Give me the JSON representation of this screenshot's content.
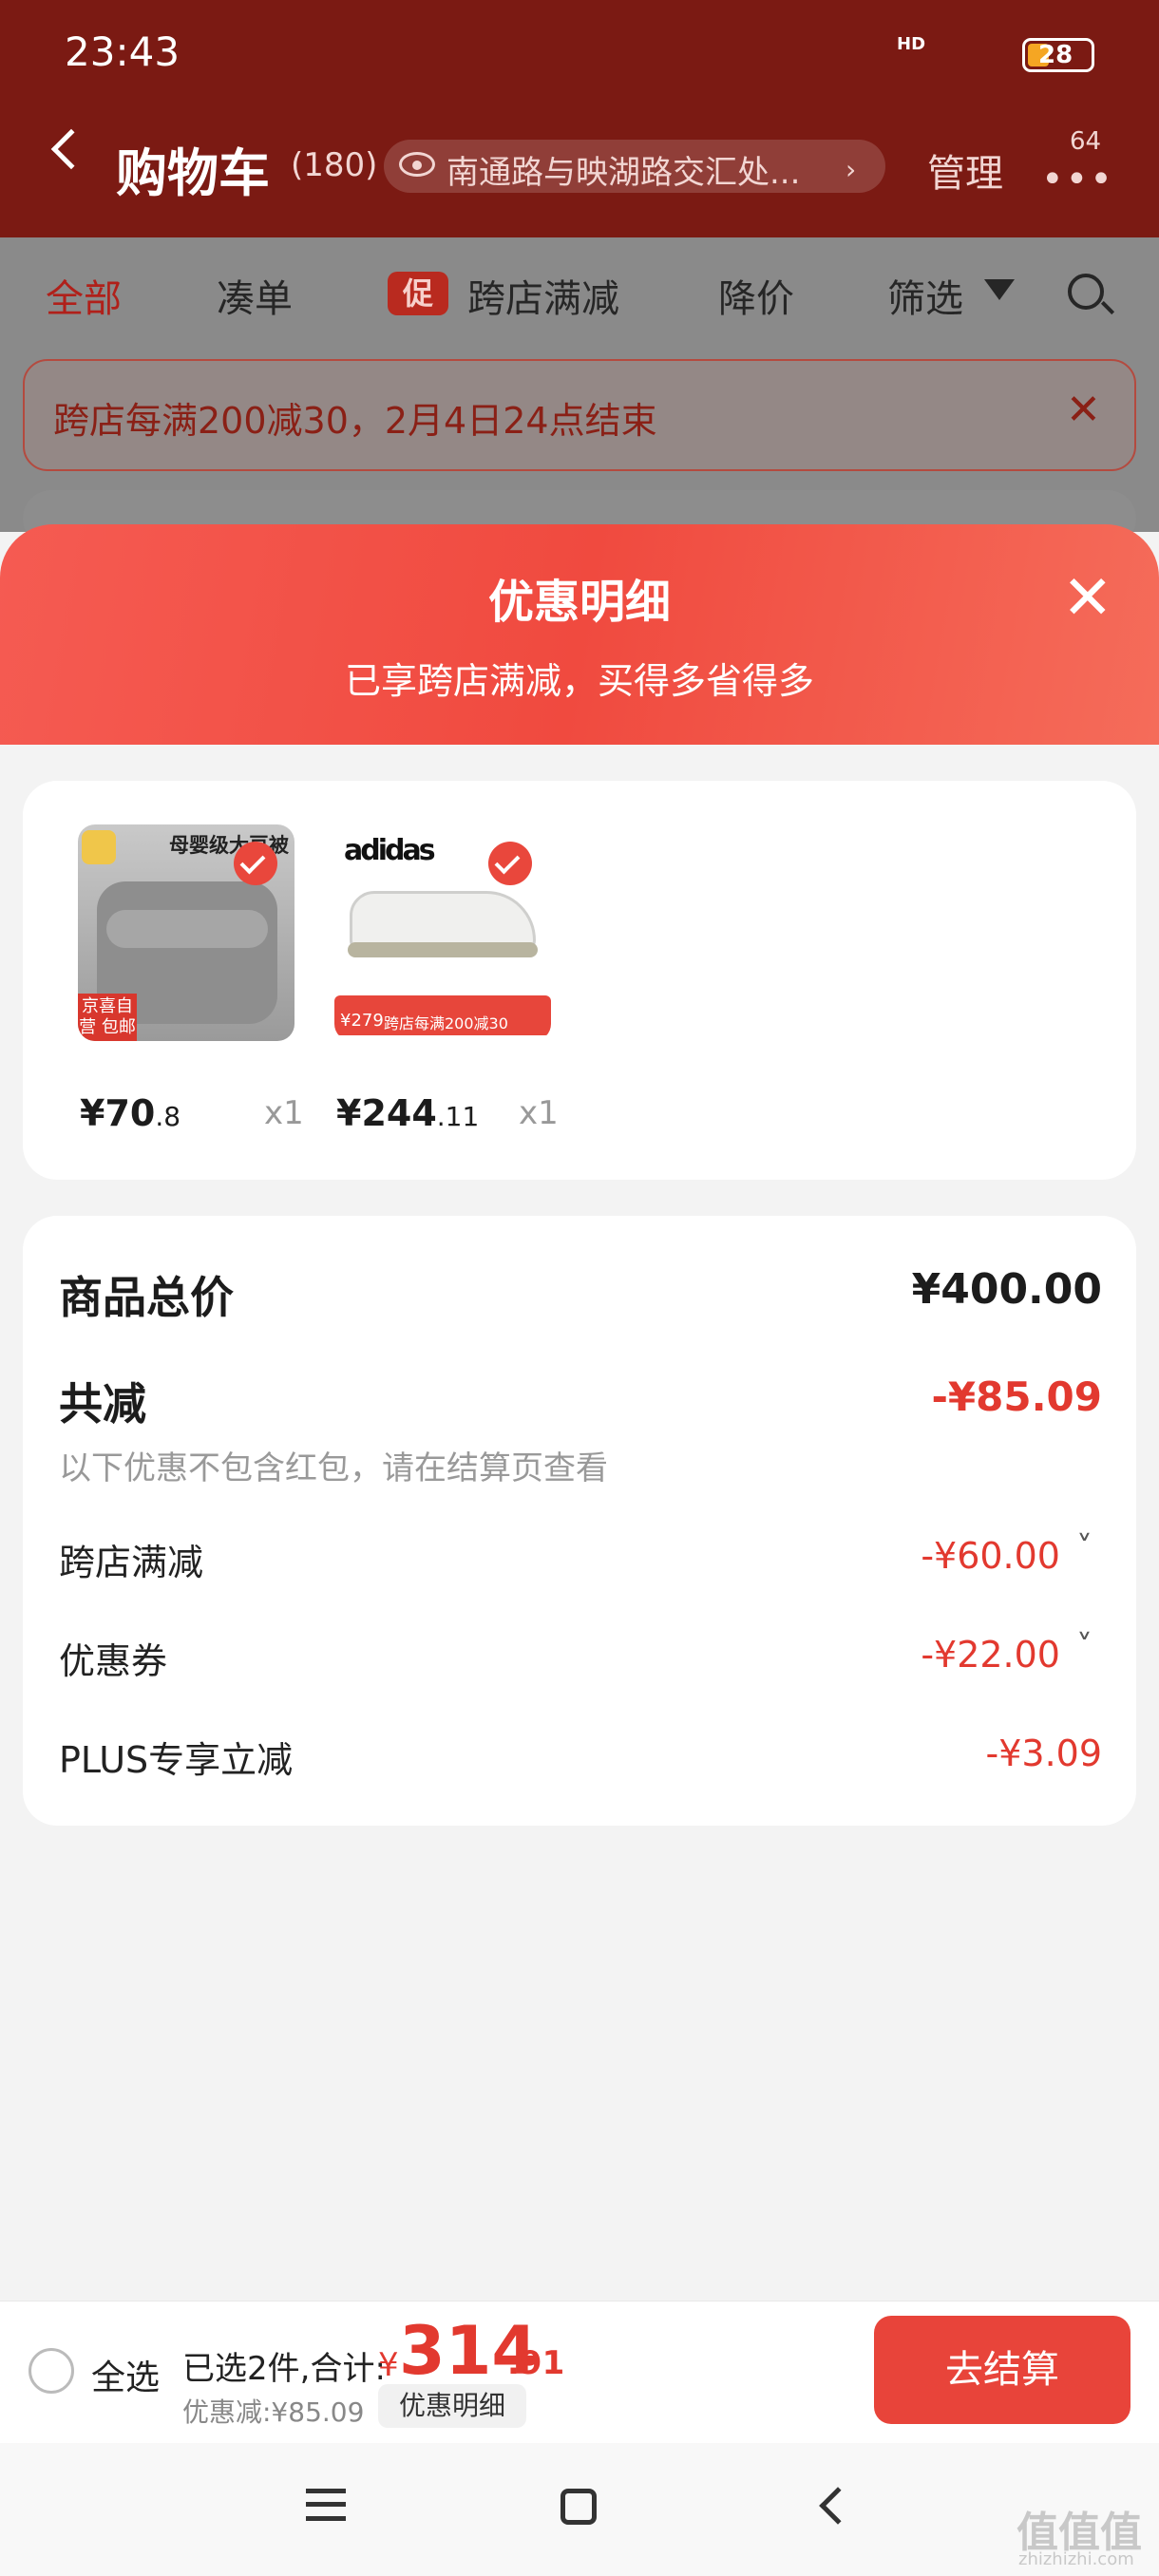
{
  "status_bar": {
    "time": "23:43",
    "hd": "HD",
    "battery": "28"
  },
  "header": {
    "title": "购物车",
    "count": "(180)",
    "address": "南通路与映湖路交汇处...",
    "address_chevron": "›",
    "manage": "管理",
    "more_badge": "64"
  },
  "tabs": {
    "all": "全部",
    "cou": "凑单",
    "promo_chip": "促",
    "cross_store": "跨店满减",
    "price_drop": "降价",
    "filter": "筛选"
  },
  "banner": {
    "text": "跨店每满200减30，2月4日24点结束",
    "close": "✕"
  },
  "sheet": {
    "title": "优惠明细",
    "subtitle": "已享跨店满减，买得多省得多",
    "close": "✕"
  },
  "products": [
    {
      "img_title": "母婴级大豆被",
      "img_tag": "京喜自营 包邮",
      "price_int": "¥70",
      "price_dec": ".8",
      "qty": "x1",
      "selected": true
    },
    {
      "img_brand": "adidas",
      "img_banner_price": "¥279",
      "img_banner_promo": "跨店每满200减30",
      "price_int": "¥244",
      "price_dec": ".11",
      "qty": "x1",
      "selected": true
    }
  ],
  "summary": {
    "total_label": "商品总价",
    "total_value": "¥400.00",
    "reduce_label": "共减",
    "reduce_value": "-¥85.09",
    "reduce_note": "以下优惠不包含红包，请在结算页查看",
    "rows": [
      {
        "label": "跨店满减",
        "value": "-¥60.00",
        "chevron": "˅"
      },
      {
        "label": "优惠券",
        "value": "-¥22.00",
        "chevron": "˅"
      },
      {
        "label": "PLUS专享立减",
        "value": "-¥3.09"
      }
    ]
  },
  "bottom": {
    "select_all": "全选",
    "selected_text": "已选2件,合计:",
    "yen": "¥",
    "total_int": "314",
    "total_dec": ".91",
    "discount_text": "优惠减:¥85.09",
    "detail_chip": "优惠明细",
    "checkout": "去结算"
  },
  "watermark": {
    "text": "值值值",
    "sub": "zhizhizhi.com"
  },
  "colors": {
    "header_bg": "#7b1a13",
    "accent_red": "#e8443a",
    "price_red": "#e2392f"
  }
}
